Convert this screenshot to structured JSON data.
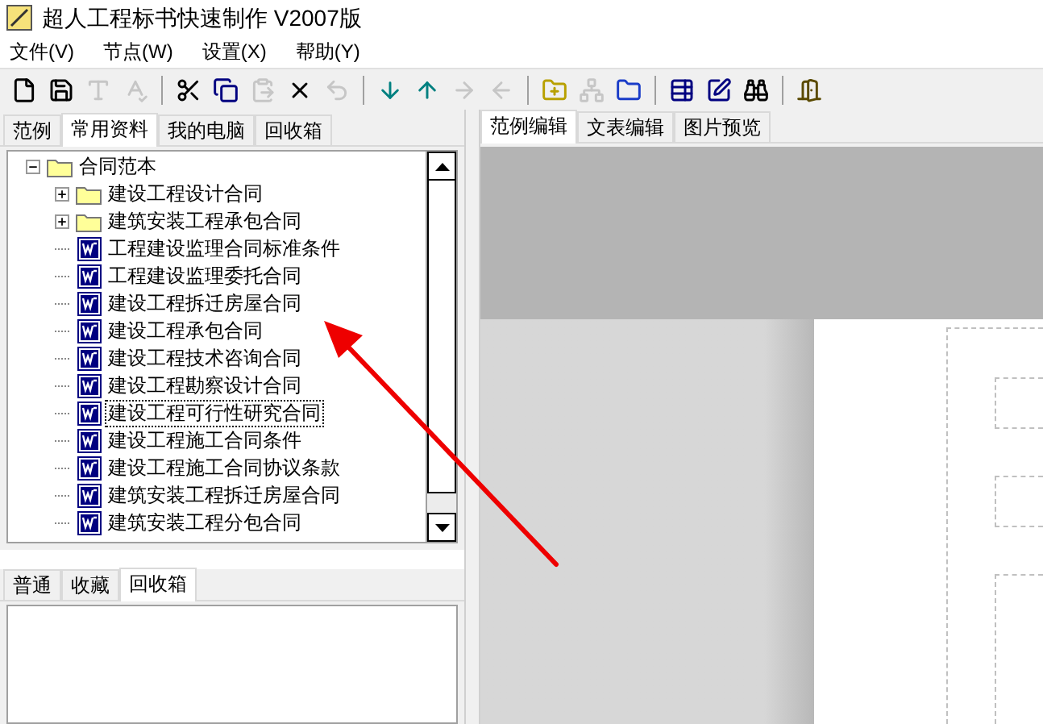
{
  "window": {
    "title": "超人工程标书快速制作 V2007版"
  },
  "menu": [
    "文件(V)",
    "节点(W)",
    "设置(X)",
    "帮助(Y)"
  ],
  "toolbar": [
    [
      {
        "kind": "new",
        "disabled": false
      },
      {
        "kind": "save",
        "disabled": false
      },
      {
        "kind": "font",
        "disabled": true
      },
      {
        "kind": "spell",
        "disabled": true
      }
    ],
    [
      {
        "kind": "cut",
        "disabled": false
      },
      {
        "kind": "copy",
        "disabled": false
      },
      {
        "kind": "paste",
        "disabled": true
      },
      {
        "kind": "delete",
        "disabled": false
      },
      {
        "kind": "undo",
        "disabled": true
      }
    ],
    [
      {
        "kind": "down",
        "disabled": false
      },
      {
        "kind": "up",
        "disabled": false
      },
      {
        "kind": "right",
        "disabled": true
      },
      {
        "kind": "left",
        "disabled": true
      }
    ],
    [
      {
        "kind": "folder-add",
        "disabled": false
      },
      {
        "kind": "node-add",
        "disabled": true
      },
      {
        "kind": "folder",
        "disabled": false
      }
    ],
    [
      {
        "kind": "table-add",
        "disabled": false
      },
      {
        "kind": "table-edit",
        "disabled": false
      },
      {
        "kind": "find",
        "disabled": false
      }
    ],
    [
      {
        "kind": "exit",
        "disabled": false
      }
    ]
  ],
  "left_tabs": [
    {
      "label": "范例",
      "selected": false
    },
    {
      "label": "常用资料",
      "selected": true
    },
    {
      "label": "我的电脑",
      "selected": false
    },
    {
      "label": "回收箱",
      "selected": false
    }
  ],
  "tree": [
    {
      "label": "合同范本",
      "kind": "folder",
      "expanded": true,
      "selected": false,
      "children": [
        {
          "label": "建设工程设计合同",
          "kind": "folder",
          "expanded": false,
          "selected": false
        },
        {
          "label": "建筑安装工程承包合同",
          "kind": "folder",
          "expanded": false,
          "selected": false
        },
        {
          "label": "工程建设监理合同标准条件",
          "kind": "doc",
          "selected": false
        },
        {
          "label": "工程建设监理委托合同",
          "kind": "doc",
          "selected": false
        },
        {
          "label": "建设工程拆迁房屋合同",
          "kind": "doc",
          "selected": false
        },
        {
          "label": "建设工程承包合同",
          "kind": "doc",
          "selected": false
        },
        {
          "label": "建设工程技术咨询合同",
          "kind": "doc",
          "selected": false
        },
        {
          "label": "建设工程勘察设计合同",
          "kind": "doc",
          "selected": false
        },
        {
          "label": "建设工程可行性研究合同",
          "kind": "doc",
          "selected": true
        },
        {
          "label": "建设工程施工合同条件",
          "kind": "doc",
          "selected": false
        },
        {
          "label": "建设工程施工合同协议条款",
          "kind": "doc",
          "selected": false
        },
        {
          "label": "建筑安装工程拆迁房屋合同",
          "kind": "doc",
          "selected": false
        },
        {
          "label": "建筑安装工程分包合同",
          "kind": "doc",
          "selected": false
        }
      ]
    }
  ],
  "bottom_tabs": [
    {
      "label": "普通",
      "selected": false
    },
    {
      "label": "收藏",
      "selected": false
    },
    {
      "label": "回收箱",
      "selected": true
    }
  ],
  "right_tabs": [
    {
      "label": "范例编辑",
      "selected": true
    },
    {
      "label": "文表编辑",
      "selected": false
    },
    {
      "label": "图片预览",
      "selected": false
    }
  ]
}
